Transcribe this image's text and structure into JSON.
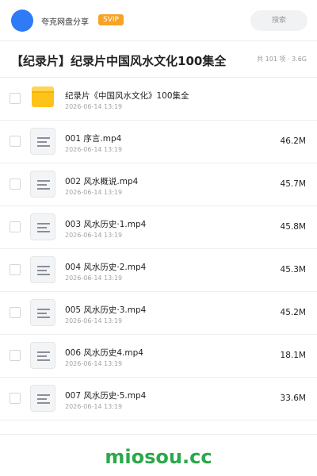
{
  "header": {
    "username": "夸克网盘分享",
    "badge": "SVIP",
    "search_placeholder": "搜索"
  },
  "share": {
    "title": "【纪录片】纪录片中国风水文化100集全",
    "summary": "共 101 项 · 3.6G"
  },
  "files": [
    {
      "name": "纪录片《中国风水文化》100集全",
      "date": "2026-06-14 13:19",
      "size": "",
      "type": "folder"
    },
    {
      "name": "001 序言.mp4",
      "date": "2026-06-14 13:19",
      "size": "46.2M",
      "type": "video"
    },
    {
      "name": "002 风水概说.mp4",
      "date": "2026-06-14 13:19",
      "size": "45.7M",
      "type": "video"
    },
    {
      "name": "003 风水历史·1.mp4",
      "date": "2026-06-14 13:19",
      "size": "45.8M",
      "type": "video"
    },
    {
      "name": "004 风水历史·2.mp4",
      "date": "2026-06-14 13:19",
      "size": "45.3M",
      "type": "video"
    },
    {
      "name": "005 风水历史·3.mp4",
      "date": "2026-06-14 13:19",
      "size": "45.2M",
      "type": "video"
    },
    {
      "name": "006 风水历史4.mp4",
      "date": "2026-06-14 13:19",
      "size": "18.1M",
      "type": "video"
    },
    {
      "name": "007 风水历史·5.mp4",
      "date": "2026-06-14 13:19",
      "size": "33.6M",
      "type": "video"
    }
  ],
  "watermark": "miosou.cc",
  "colors": {
    "accent": "#2f7bf6",
    "badge": "#f7a325",
    "folder": "#ffc21a",
    "watermark": "#2ba84a"
  }
}
